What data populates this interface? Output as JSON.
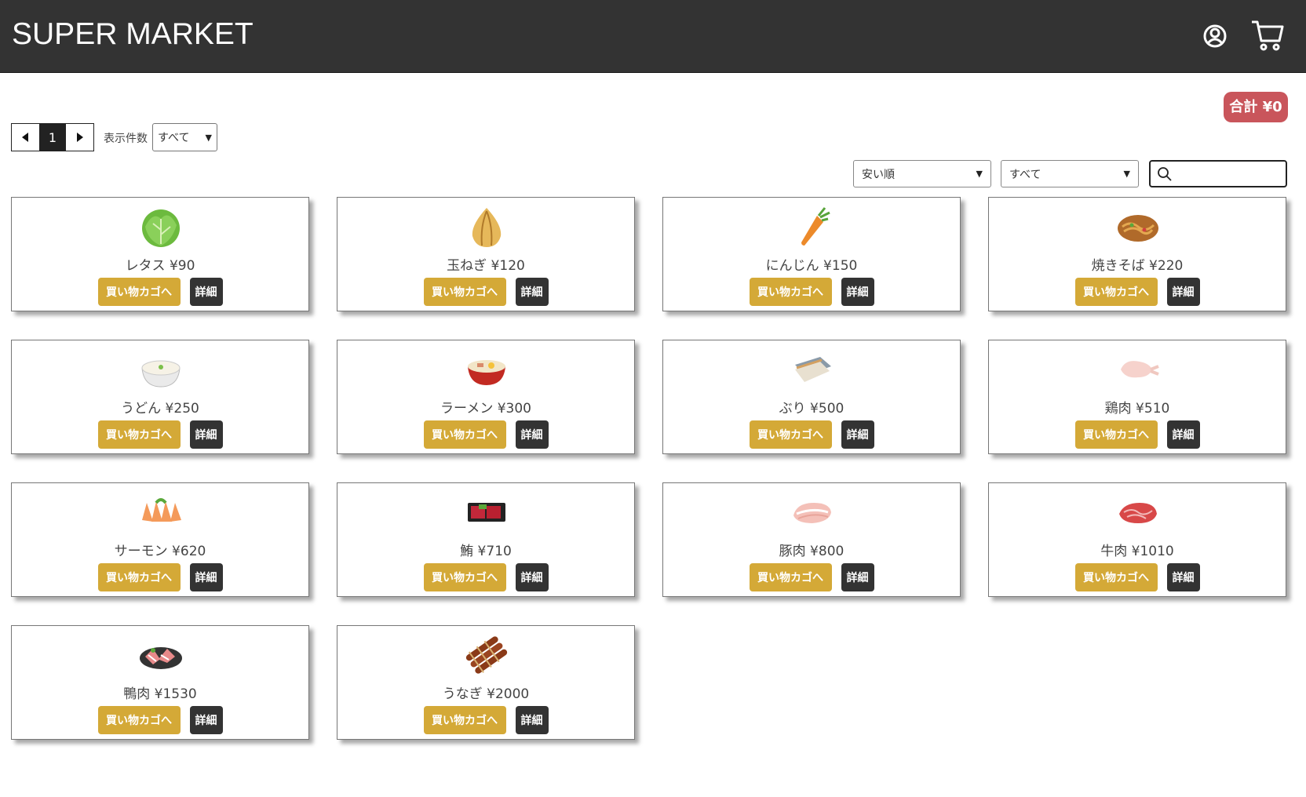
{
  "header": {
    "brand": "SUPER MARKET",
    "icons": [
      "user-icon",
      "cart-icon"
    ]
  },
  "total": "合計 ¥0",
  "pager": {
    "current_page": "1",
    "count_label": "表示件数",
    "count_value": "すべて"
  },
  "filters": {
    "sort_value": "安い順",
    "category_value": "すべて",
    "search_value": ""
  },
  "buttons": {
    "add_to_cart": "買い物カゴへ",
    "details": "詳細"
  },
  "colors": {
    "header_bg": "#333333",
    "cart_button": "#d4a937",
    "detail_button": "#333333",
    "total_badge": "#c9555b"
  },
  "products": [
    {
      "name": "レタス ¥90",
      "icon": "lettuce-icon"
    },
    {
      "name": "玉ねぎ ¥120",
      "icon": "onion-icon"
    },
    {
      "name": "にんじん ¥150",
      "icon": "carrot-icon"
    },
    {
      "name": "焼きそば ¥220",
      "icon": "yakisoba-icon"
    },
    {
      "name": "うどん ¥250",
      "icon": "udon-icon"
    },
    {
      "name": "ラーメン ¥300",
      "icon": "ramen-icon"
    },
    {
      "name": "ぶり ¥500",
      "icon": "yellowtail-icon"
    },
    {
      "name": "鶏肉 ¥510",
      "icon": "chicken-icon"
    },
    {
      "name": "サーモン ¥620",
      "icon": "salmon-icon"
    },
    {
      "name": "鮪 ¥710",
      "icon": "tuna-icon"
    },
    {
      "name": "豚肉 ¥800",
      "icon": "pork-icon"
    },
    {
      "name": "牛肉 ¥1010",
      "icon": "beef-icon"
    },
    {
      "name": "鴨肉 ¥1530",
      "icon": "duck-icon"
    },
    {
      "name": "うなぎ ¥2000",
      "icon": "eel-icon"
    }
  ]
}
